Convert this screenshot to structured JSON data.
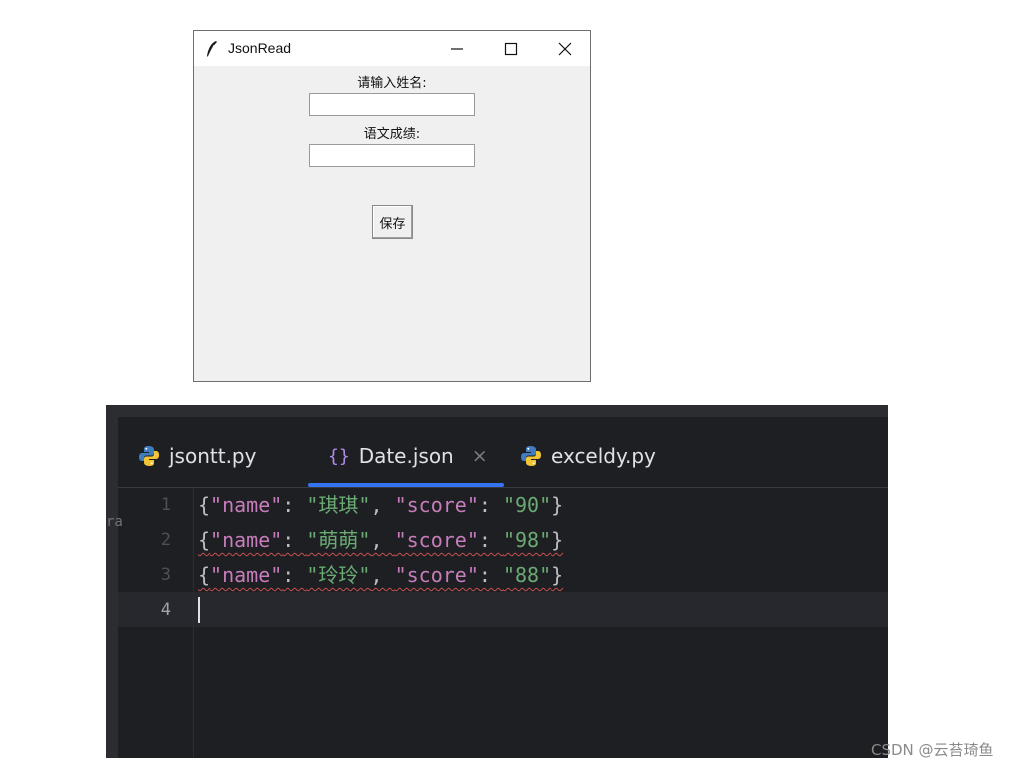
{
  "tk_window": {
    "title": "JsonRead",
    "name_label": "请输入姓名:",
    "name_value": "",
    "score_label": "语文成绩:",
    "score_value": "",
    "save_button": "保存",
    "controls": {
      "minimize": "—",
      "maximize": "☐",
      "close": "✕"
    }
  },
  "editor": {
    "tabs": [
      {
        "label": "jsontt.py",
        "icon": "python-icon",
        "active": false
      },
      {
        "label": "Date.json",
        "icon": "json-braces-icon",
        "active": true,
        "close": "×"
      },
      {
        "label": "exceldy.py",
        "icon": "python-icon",
        "active": false
      }
    ],
    "left_strip_glyph": "ra",
    "line_numbers": [
      "1",
      "2",
      "3",
      "4"
    ],
    "lines": [
      {
        "open": "{",
        "k1": "\"name\"",
        "c1": ": ",
        "v1": "\"琪琪\"",
        "c2": ", ",
        "k2": "\"score\"",
        "c3": ": ",
        "v2": "\"90\"",
        "close": "}"
      },
      {
        "open": "{",
        "k1": "\"name\"",
        "c1": ": ",
        "v1": "\"萌萌\"",
        "c2": ", ",
        "k2": "\"score\"",
        "c3": ": ",
        "v2": "\"98\"",
        "close": "}"
      },
      {
        "open": "{",
        "k1": "\"name\"",
        "c1": ": ",
        "v1": "\"玲玲\"",
        "c2": ", ",
        "k2": "\"score\"",
        "c3": ": ",
        "v2": "\"88\"",
        "close": "}"
      }
    ],
    "colors": {
      "background": "#1e1f22",
      "accent": "#3574f0",
      "key": "#c77dbb",
      "string": "#6aab73"
    }
  },
  "watermark": "CSDN @云苔琦鱼"
}
